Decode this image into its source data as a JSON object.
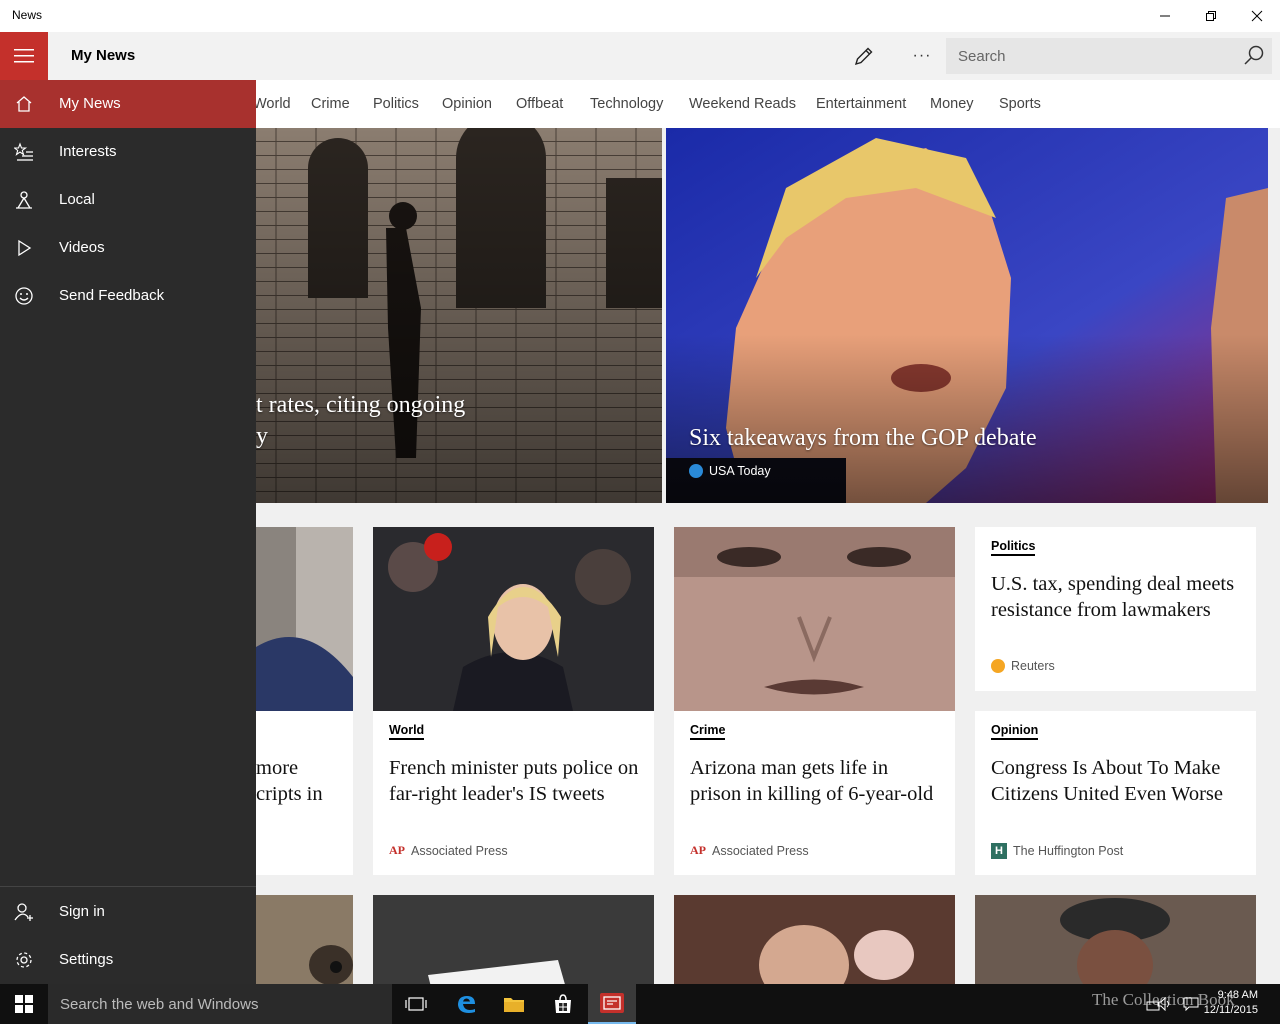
{
  "window": {
    "title": "News"
  },
  "appbar": {
    "title": "My News",
    "search_placeholder": "Search"
  },
  "tabs": [
    "World",
    "Crime",
    "Politics",
    "Opinion",
    "Offbeat",
    "Technology",
    "Weekend Reads",
    "Entertainment",
    "Money",
    "Sports"
  ],
  "nav": {
    "top": [
      {
        "label": "My News",
        "icon": "home-icon",
        "active": true
      },
      {
        "label": "Interests",
        "icon": "star-list-icon"
      },
      {
        "label": "Local",
        "icon": "location-icon"
      },
      {
        "label": "Videos",
        "icon": "play-icon"
      },
      {
        "label": "Send Feedback",
        "icon": "smiley-icon"
      }
    ],
    "bottom": [
      {
        "label": "Sign in",
        "icon": "add-user-icon"
      },
      {
        "label": "Settings",
        "icon": "gear-icon"
      }
    ]
  },
  "hero": [
    {
      "title_line1": "t rates, citing ongoing",
      "title_line2": "y"
    },
    {
      "title": "Six takeaways from the GOP debate",
      "source": "USA Today"
    }
  ],
  "cards": [
    {
      "title_line1": "more",
      "title_line2": "cripts in"
    },
    {
      "category": "World",
      "title": "French minister puts police on far-right leader's IS tweets",
      "source": "Associated Press"
    },
    {
      "category": "Crime",
      "title": "Arizona man gets life in prison in killing of 6-year-old",
      "source": "Associated Press"
    },
    {
      "category": "Politics",
      "title": "U.S. tax, spending deal meets resistance from lawmakers",
      "source": "Reuters"
    },
    {
      "category": "Opinion",
      "title": "Congress Is About To Make Citizens United Even Worse",
      "source": "The Huffington Post"
    }
  ],
  "taskbar": {
    "search_placeholder": "Search the web and Windows",
    "time": "9:48 AM",
    "date": "12/11/2015",
    "watermark": "The Collection Book"
  },
  "colors": {
    "accent": "#c4302b",
    "nav_active": "#a8312e",
    "nav_bg": "#2b2b2b"
  }
}
